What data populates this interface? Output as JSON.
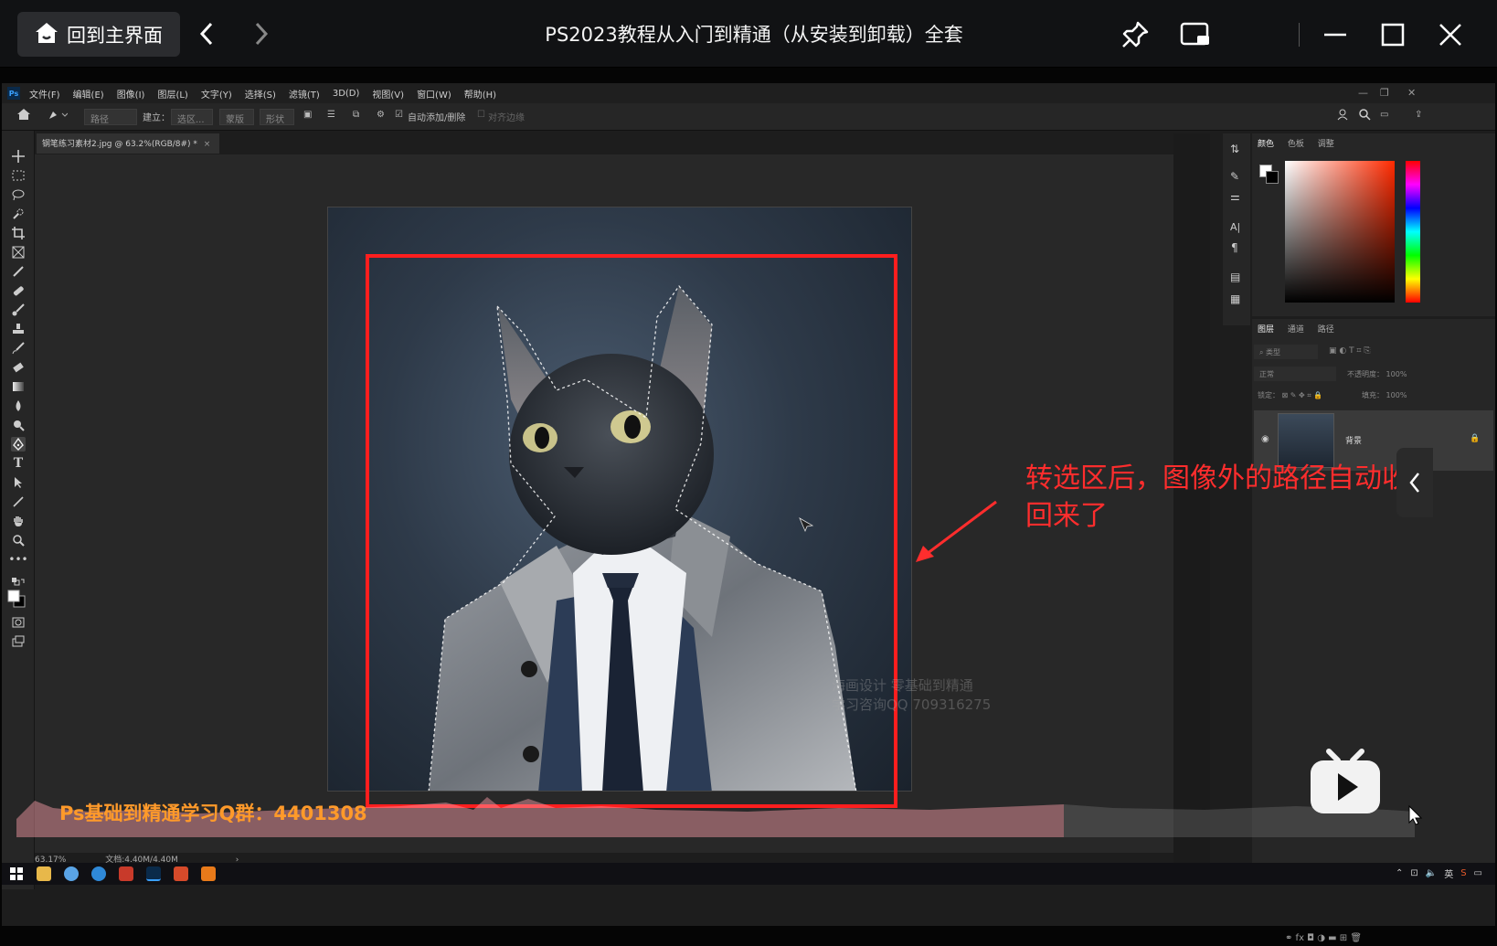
{
  "player": {
    "home_label": "回到主界面",
    "title": "PS2023教程从入门到精通（从安装到卸载）全套"
  },
  "ps": {
    "menus": [
      "文件(F)",
      "编辑(E)",
      "图像(I)",
      "图层(L)",
      "文字(Y)",
      "选择(S)",
      "滤镜(T)",
      "3D(D)",
      "视图(V)",
      "窗口(W)",
      "帮助(H)"
    ],
    "options": {
      "mode": "路径",
      "build_label": "建立：",
      "selection_btn": "选区...",
      "mask_btn": "蒙版",
      "shape_btn": "形状",
      "auto_add": "自动添加/删除",
      "align_edges": "对齐边缘"
    },
    "doc_tab": "钢笔练习素材2.jpg @ 63.2%(RGB/8#) *",
    "status": {
      "zoom": "63.17%",
      "doc_size": "文档:4.40M/4.40M"
    },
    "color_tabs": [
      "颜色",
      "色板",
      "调整"
    ],
    "layer_tabs": [
      "图层",
      "通道",
      "路径"
    ],
    "layers": {
      "kind_placeholder": "类型",
      "blend_mode": "正常",
      "opacity_label": "不透明度：",
      "opacity": "100%",
      "lock_label": "锁定：",
      "fill_label": "填充：",
      "fill": "100%",
      "layer_name": "背景"
    }
  },
  "overlay": {
    "annotation_line1": "转选区后，图像外的路径自动收",
    "annotation_line2": "回来了",
    "watermark_line1": "海画设计 零基础到精通",
    "watermark_line2": "学习咨询QQ 709316275",
    "qq_banner": "Ps基础到精通学习Q群：4401308"
  },
  "taskbar": {
    "ime": "英"
  },
  "colors": {
    "annotation": "#ff2d2d",
    "banner": "#ff9a2a",
    "red_box": "#ff1e1e"
  }
}
